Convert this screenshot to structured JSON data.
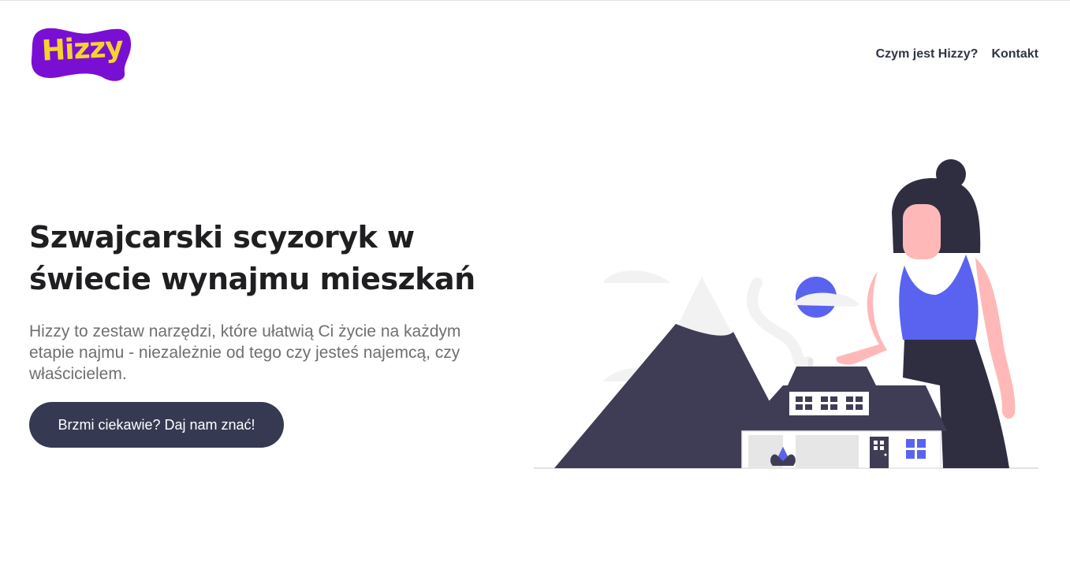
{
  "header": {
    "logo_text": "Hizzy",
    "nav": [
      {
        "label": "Czym jest Hizzy?"
      },
      {
        "label": "Kontakt"
      }
    ]
  },
  "hero": {
    "title": "Szwajcarski scyzoryk w świecie wynajmu mieszkań",
    "subtitle": "Hizzy to zestaw narzędzi, które ułatwią Ci życie na każdym etapie najmu - niezależnie od tego czy jesteś najemcą, czy właścicielem.",
    "cta_label": "Brzmi ciekawie? Daj nam znać!"
  },
  "colors": {
    "brand_purple": "#7a0fd4",
    "brand_yellow": "#f6d22c",
    "cta_bg": "#353a52",
    "accent_blue": "#5a63f0",
    "dark_navy": "#3f3d56"
  }
}
